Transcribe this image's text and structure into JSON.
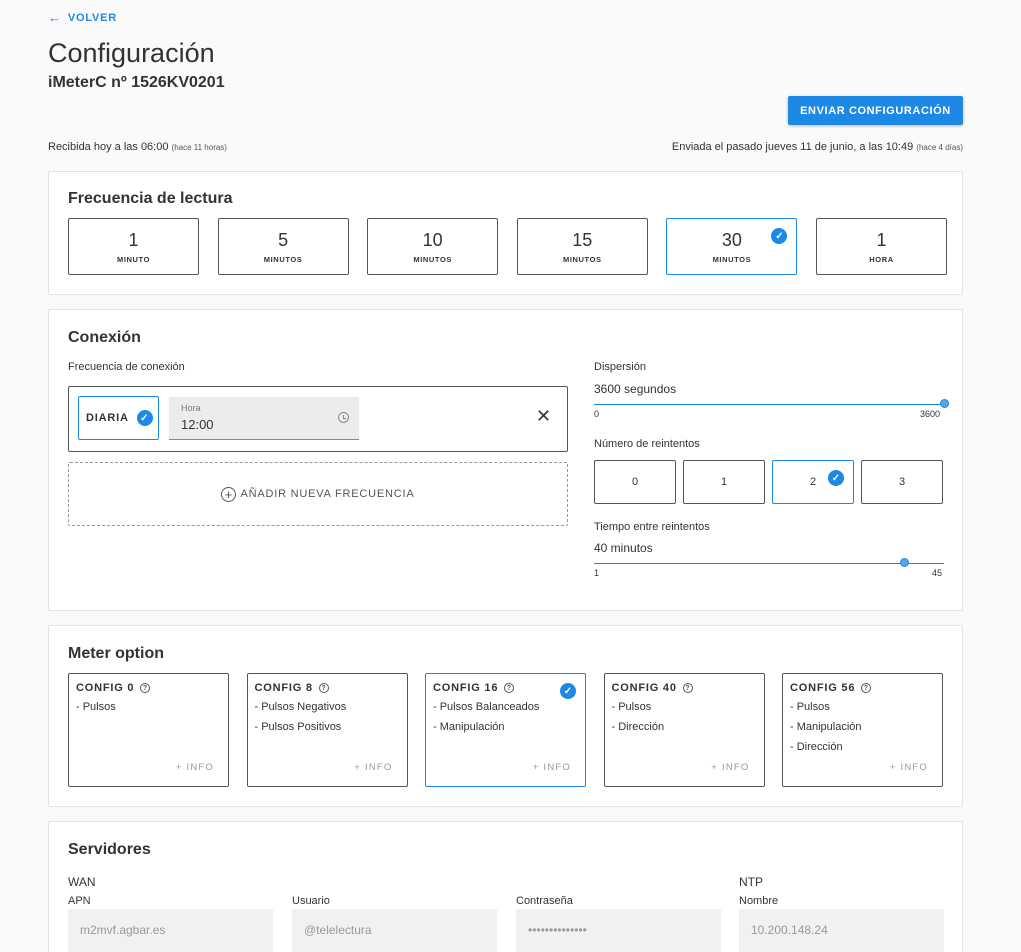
{
  "header": {
    "back_label": "VOLVER",
    "title": "Configuración",
    "subtitle": "iMeterC nº 1526KV0201",
    "send_button": "ENVIAR CONFIGURACIÓN",
    "received_text": "Recibida hoy a las 06:00",
    "received_small": "(hace 11 horas)",
    "sent_text": "Enviada el pasado jueves 11 de junio, a las 10:49",
    "sent_small": "(hace 4 días)"
  },
  "frecuencia": {
    "title": "Frecuencia de lectura",
    "options": [
      {
        "num": "1",
        "unit": "MINUTO",
        "selected": false
      },
      {
        "num": "5",
        "unit": "MINUTOS",
        "selected": false
      },
      {
        "num": "10",
        "unit": "MINUTOS",
        "selected": false
      },
      {
        "num": "15",
        "unit": "MINUTOS",
        "selected": false
      },
      {
        "num": "30",
        "unit": "MINUTOS",
        "selected": true
      },
      {
        "num": "1",
        "unit": "HORA",
        "selected": false
      }
    ]
  },
  "conexion": {
    "title": "Conexión",
    "freq_label": "Frecuencia de conexión",
    "diaria_label": "DIARIA",
    "hora_label": "Hora",
    "hora_value": "12:00",
    "add_label": "AÑADIR NUEVA FRECUENCIA",
    "dispersion_label": "Dispersión",
    "dispersion_value": "3600 segundos",
    "dispersion_min": "0",
    "dispersion_max": "3600",
    "dispersion_level": 1.0,
    "reintentos_label": "Número de reintentos",
    "reintentos": [
      {
        "label": "0",
        "selected": false
      },
      {
        "label": "1",
        "selected": false
      },
      {
        "label": "2",
        "selected": true
      },
      {
        "label": "3",
        "selected": false
      }
    ],
    "tiempo_label": "Tiempo entre reintentos",
    "tiempo_value": "40 minutos",
    "tiempo_min": "1",
    "tiempo_max": "45",
    "tiempo_level": 0.886
  },
  "meter": {
    "title": "Meter option",
    "info_label": "+ INFO",
    "configs": [
      {
        "name": "CONFIG 0",
        "features": [
          "- Pulsos"
        ],
        "selected": false
      },
      {
        "name": "CONFIG 8",
        "features": [
          "- Pulsos Negativos",
          "- Pulsos Positivos"
        ],
        "selected": false
      },
      {
        "name": "CONFIG 16",
        "features": [
          "- Pulsos Balanceados",
          "- Manipulación"
        ],
        "selected": true
      },
      {
        "name": "CONFIG 40",
        "features": [
          "- Pulsos",
          "- Dirección"
        ],
        "selected": false
      },
      {
        "name": "CONFIG 56",
        "features": [
          "- Pulsos",
          "- Manipulación",
          "- Dirección"
        ],
        "selected": false
      }
    ]
  },
  "servidores": {
    "title": "Servidores",
    "wan_label": "WAN",
    "ntp_label": "NTP",
    "apn_label": "APN",
    "apn_value": "m2mvf.agbar.es",
    "usuario_label": "Usuario",
    "usuario_value": "@telelectura",
    "password_label": "Contraseña",
    "password_value": "••••••••••••••",
    "nombre_label": "Nombre",
    "nombre_value": "10.200.148.24"
  },
  "colors": {
    "accent": "#1e88e5",
    "border": "#555555",
    "background": "#fafafa"
  }
}
